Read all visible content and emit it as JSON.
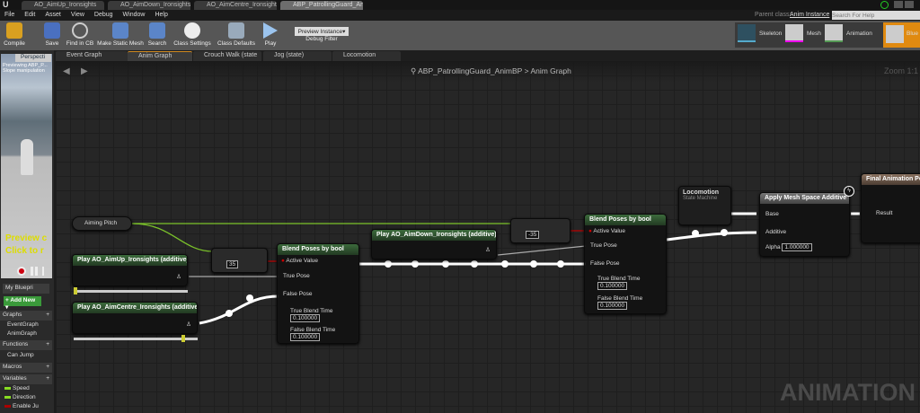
{
  "window_tabs": [
    "AO_AimUp_Ironsights",
    "AO_AimDown_Ironsights",
    "AO_AimCentre_Ironsights",
    "ABP_PatrollingGuard_Anim"
  ],
  "menu": [
    "File",
    "Edit",
    "Asset",
    "View",
    "Debug",
    "Window",
    "Help"
  ],
  "parent_class_label": "Parent class:",
  "parent_class": "Anim Instance",
  "search_help_placeholder": "Search For Help",
  "toolbar": {
    "compile": "Compile",
    "save": "Save",
    "find": "Find in CB",
    "make_mesh": "Make Static Mesh",
    "search": "Search",
    "class_settings": "Class Settings",
    "class_defaults": "Class Defaults",
    "play": "Play",
    "debug_value": "Preview Instance▾",
    "debug_label": "Debug Filter"
  },
  "modes": {
    "skeleton": "Skeleton",
    "mesh": "Mesh",
    "animation": "Animation",
    "blueprint": "Blue"
  },
  "graph_tabs": [
    "Event Graph",
    "Anim Graph",
    "Crouch Walk (state",
    "Jog (state)",
    "Locomotion"
  ],
  "viewport": {
    "label": "Perspecti",
    "info": "Previewing ABP_P...",
    "info2": "Slope manipulation",
    "preview1": "Preview c",
    "preview2": "Click to r"
  },
  "breadcrumb": {
    "bp": "ABP_PatrollingGuard_AnimBP",
    "sep": ">",
    "graph": "Anim Graph"
  },
  "zoom": "Zoom 1:1",
  "watermark": "ANIMATION",
  "sidebar": {
    "title": "My Bluepri",
    "add_new": "+ Add New ▾",
    "graphs": "Graphs",
    "event_graph": "EventGraph",
    "anim_graph": "AnimGraph",
    "functions": "Functions",
    "can_jump": "Can Jump",
    "macros": "Macros",
    "variables": "Variables",
    "vars": [
      "Speed",
      "Direction",
      "Enable Ju"
    ]
  },
  "nodes": {
    "aiming_pitch": "Aiming Pitch",
    "aim_up": "Play AO_AimUp_Ironsights (additive)",
    "aim_centre": "Play AO_AimCentre_Ironsights (additive)",
    "aim_down": "Play AO_AimDown_Ironsights (additive)",
    "cmp1": "35",
    "cmp2": "-35",
    "blend_title": "Blend Poses by bool",
    "active": "Active Value",
    "true_pose": "True Pose",
    "false_pose": "False Pose",
    "true_bt": "True Blend Time",
    "false_bt": "False Blend Time",
    "bt_val": "0.100000",
    "loco": "Locomotion",
    "loco_sub": "State Machine",
    "apply": "Apply Mesh Space Additive",
    "base": "Base",
    "additive": "Additive",
    "alpha": "Alpha",
    "alpha_val": "1.000000",
    "final": "Final Animation Pose",
    "result": "Result"
  }
}
